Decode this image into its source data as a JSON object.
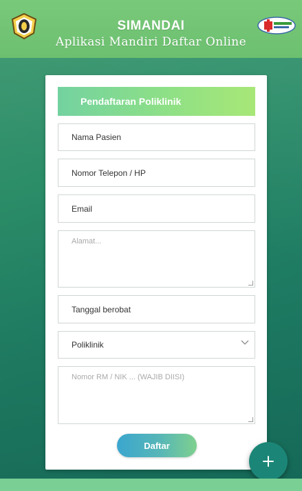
{
  "header": {
    "title": "SIMANDAI",
    "subtitle": "Aplikasi Mandiri Daftar Online"
  },
  "form": {
    "heading": "Pendaftaran Poliklinik",
    "fields": {
      "nama": "Nama Pasien",
      "telepon": "Nomor Telepon / HP",
      "email": "Email",
      "alamat_placeholder": "Alamat...",
      "tanggal": "Tanggal berobat",
      "poliklinik": "Poliklinik",
      "rm_placeholder": "Nomor RM / NIK ... (WAJIB DIISI)"
    },
    "submit_label": "Daftar"
  },
  "fab": {
    "icon": "plus-icon",
    "label": "+"
  },
  "colors": {
    "header_green": "#6cc06f",
    "background_green": "#1f7d63",
    "fab_teal": "#1b8677"
  }
}
